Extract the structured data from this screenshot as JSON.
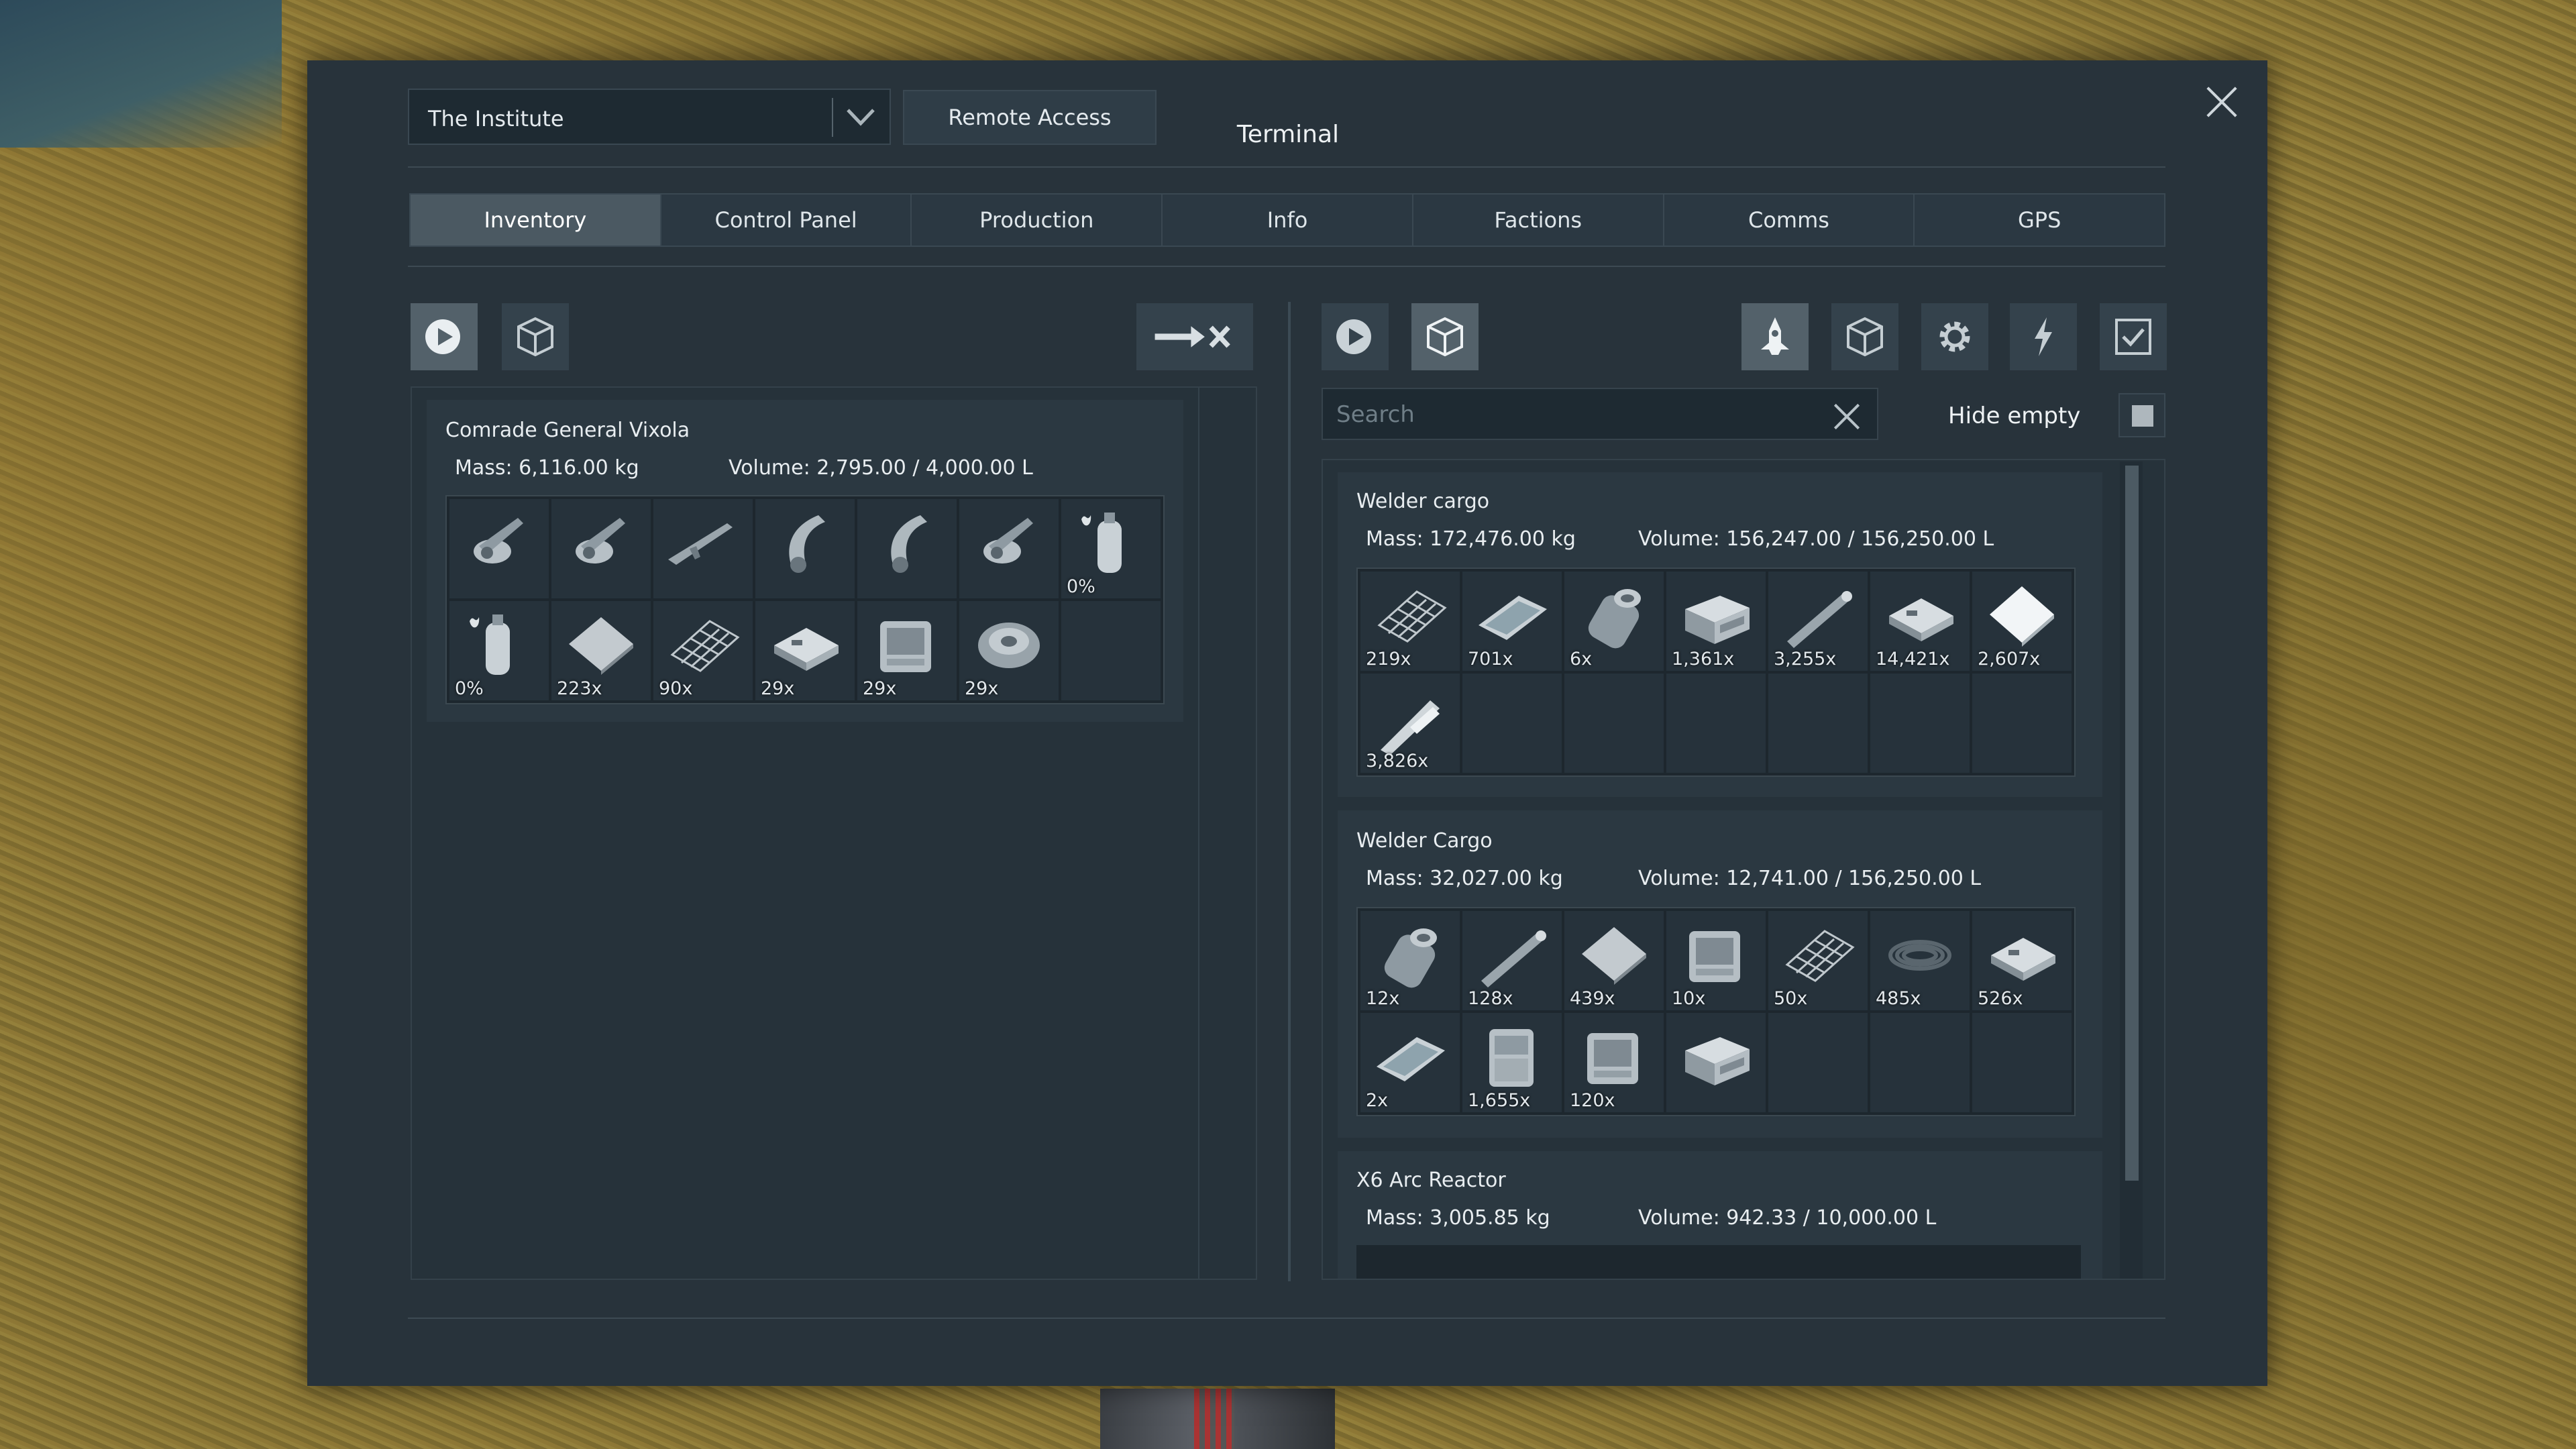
{
  "window": {
    "title": "Terminal"
  },
  "header": {
    "grid_selector": "The Institute",
    "remote_access": "Remote Access"
  },
  "tabs": [
    {
      "label": "Inventory",
      "active": true
    },
    {
      "label": "Control Panel"
    },
    {
      "label": "Production"
    },
    {
      "label": "Info"
    },
    {
      "label": "Factions"
    },
    {
      "label": "Comms"
    },
    {
      "label": "GPS"
    }
  ],
  "left": {
    "filter_icons": [
      "character-icon",
      "container-icon"
    ],
    "transfer_icon": "transfer-arrow-icon",
    "inventory": {
      "name": "Comrade General Vixola",
      "mass": "Mass: 6,116.00 kg",
      "volume": "Volume: 2,795.00 / 4,000.00 L",
      "items": [
        {
          "icon": "grinder-icon",
          "count": ""
        },
        {
          "icon": "grinder-icon",
          "count": ""
        },
        {
          "icon": "rifle-icon",
          "count": ""
        },
        {
          "icon": "welder-icon",
          "count": ""
        },
        {
          "icon": "welder-icon",
          "count": ""
        },
        {
          "icon": "grinder-icon",
          "count": ""
        },
        {
          "icon": "hydrogen-bottle-icon",
          "count": "0%"
        },
        {
          "icon": "oxygen-bottle-icon",
          "count": "0%"
        },
        {
          "icon": "steel-plate-icon",
          "count": "223x"
        },
        {
          "icon": "metal-grid-icon",
          "count": "90x"
        },
        {
          "icon": "construction-component-icon",
          "count": "29x"
        },
        {
          "icon": "computer-icon",
          "count": "29x"
        },
        {
          "icon": "motor-icon",
          "count": "29x"
        },
        {
          "icon": "",
          "count": ""
        }
      ]
    }
  },
  "right": {
    "filter_icons": [
      "character-icon",
      "container-icon"
    ],
    "category_icons": [
      "ship-icon",
      "cargo-icon",
      "gear-icon",
      "power-icon",
      "checkbox-icon"
    ],
    "search_placeholder": "Search",
    "hide_empty": "Hide empty",
    "inventories": [
      {
        "name": "Welder cargo",
        "mass": "Mass: 172,476.00 kg",
        "volume": "Volume: 156,247.00 / 156,250.00 L",
        "items": [
          {
            "icon": "metal-grid-icon",
            "count": "219x"
          },
          {
            "icon": "display-icon",
            "count": "701x"
          },
          {
            "icon": "thruster-component-icon",
            "count": "6x"
          },
          {
            "icon": "power-cell-icon",
            "count": "1,361x"
          },
          {
            "icon": "large-tube-icon",
            "count": "3,255x"
          },
          {
            "icon": "construction-component-icon",
            "count": "14,421x"
          },
          {
            "icon": "bulletproof-glass-icon",
            "count": "2,607x"
          },
          {
            "icon": "small-tube-icon",
            "count": "3,826x"
          },
          {
            "icon": "",
            "count": ""
          },
          {
            "icon": "",
            "count": ""
          },
          {
            "icon": "",
            "count": ""
          },
          {
            "icon": "",
            "count": ""
          },
          {
            "icon": "",
            "count": ""
          },
          {
            "icon": "",
            "count": ""
          }
        ]
      },
      {
        "name": "Welder Cargo",
        "mass": "Mass: 32,027.00 kg",
        "volume": "Volume: 12,741.00 / 156,250.00 L",
        "items": [
          {
            "icon": "thruster-component-icon",
            "count": "12x"
          },
          {
            "icon": "large-tube-icon",
            "count": "128x"
          },
          {
            "icon": "steel-plate-icon",
            "count": "439x"
          },
          {
            "icon": "computer-icon",
            "count": "10x"
          },
          {
            "icon": "metal-grid-icon",
            "count": "50x"
          },
          {
            "icon": "girder-icon",
            "count": "485x"
          },
          {
            "icon": "construction-component-icon",
            "count": "526x"
          },
          {
            "icon": "display-icon",
            "count": "2x"
          },
          {
            "icon": "interior-plate-icon",
            "count": "1,655x"
          },
          {
            "icon": "computer-icon",
            "count": "120x"
          },
          {
            "icon": "power-cell-icon",
            "count": ""
          },
          {
            "icon": "",
            "count": ""
          },
          {
            "icon": "",
            "count": ""
          },
          {
            "icon": "",
            "count": ""
          }
        ]
      },
      {
        "name": "X6 Arc Reactor",
        "mass": "Mass: 3,005.85 kg",
        "volume": "Volume: 942.33 / 10,000.00 L"
      }
    ]
  }
}
